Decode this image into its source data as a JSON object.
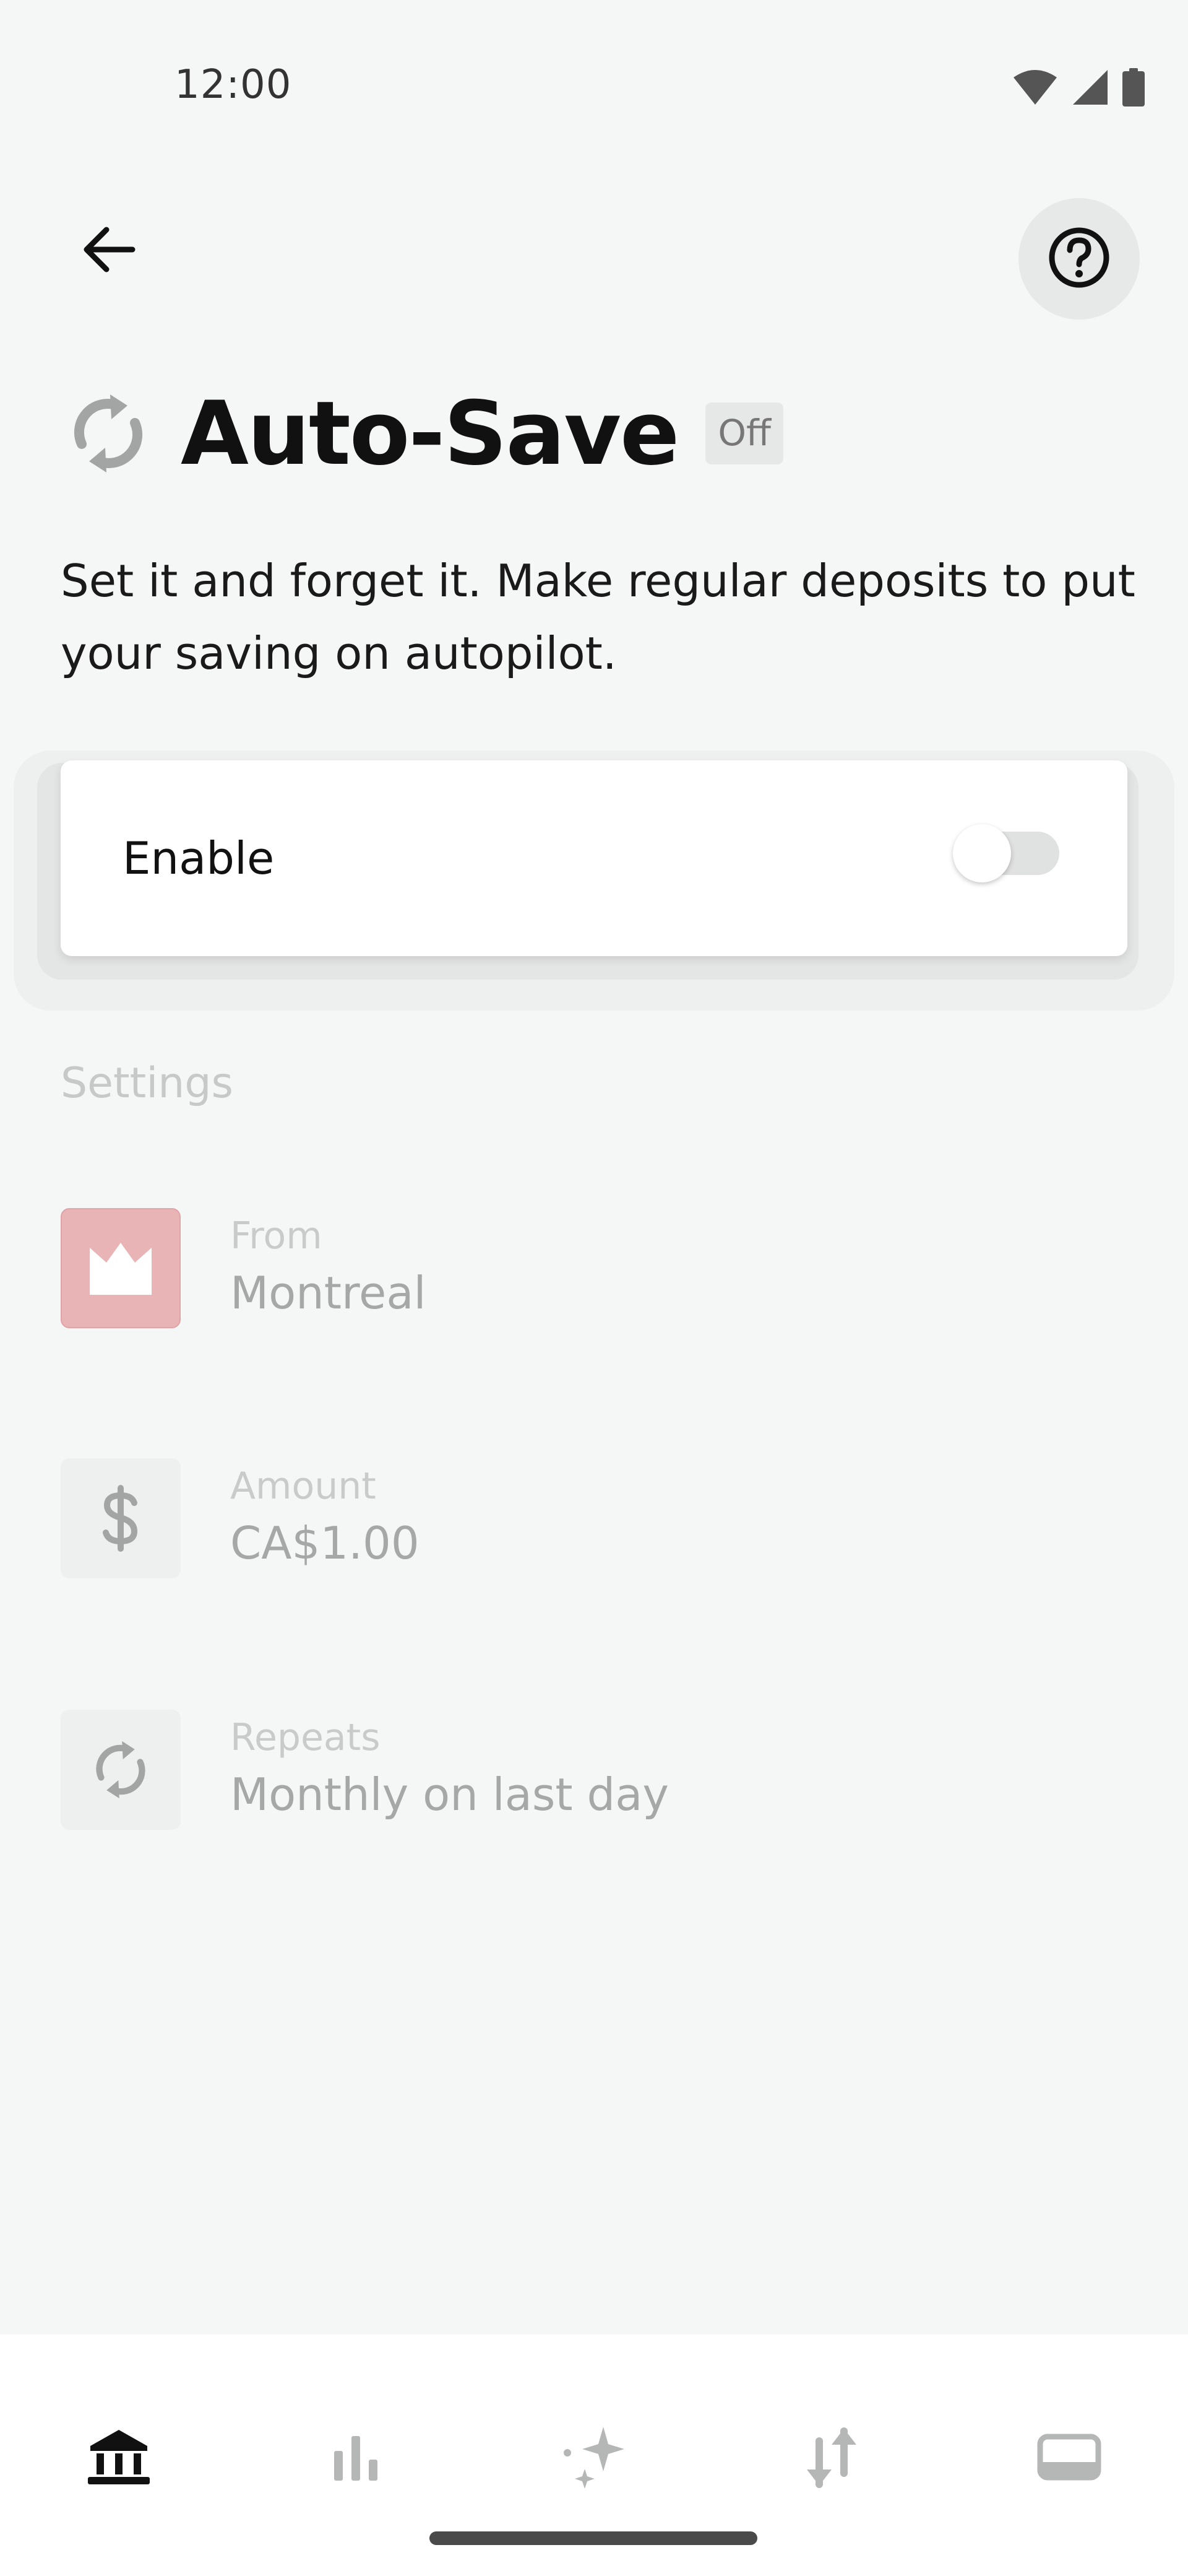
{
  "status_bar": {
    "time": "12:00",
    "icons": [
      "wifi-icon",
      "cell-signal-icon",
      "battery-icon"
    ]
  },
  "nav": {
    "back_icon": "arrow-left-icon",
    "help_icon": "question-circle-icon"
  },
  "header": {
    "icon": "sync-icon",
    "title": "Auto-Save",
    "status": "Off"
  },
  "description": "Set it and forget it. Make regular deposits to put your saving on autopilot.",
  "enable_card": {
    "label": "Enable",
    "toggle_on": false
  },
  "settings": {
    "heading": "Settings",
    "items": [
      {
        "icon": "bank-logo-icon",
        "label": "From",
        "value": "Montreal"
      },
      {
        "icon": "dollar-icon",
        "label": "Amount",
        "value": "CA$1.00"
      },
      {
        "icon": "repeat-icon",
        "label": "Repeats",
        "value": "Monthly on last day"
      }
    ]
  },
  "bottom_nav": {
    "items": [
      {
        "icon": "bank-icon",
        "active": true
      },
      {
        "icon": "bar-chart-icon",
        "active": false
      },
      {
        "icon": "sparkle-icon",
        "active": false
      },
      {
        "icon": "transfer-arrows-icon",
        "active": false
      },
      {
        "icon": "card-icon",
        "active": false
      }
    ]
  },
  "colors": {
    "background": "#f5f6f6",
    "text_primary": "#111111",
    "disabled_text": "#a6a8a8",
    "bank_brand": "#e9b4b6",
    "nav_active": "#111111",
    "nav_inactive": "#b5b7b7"
  }
}
